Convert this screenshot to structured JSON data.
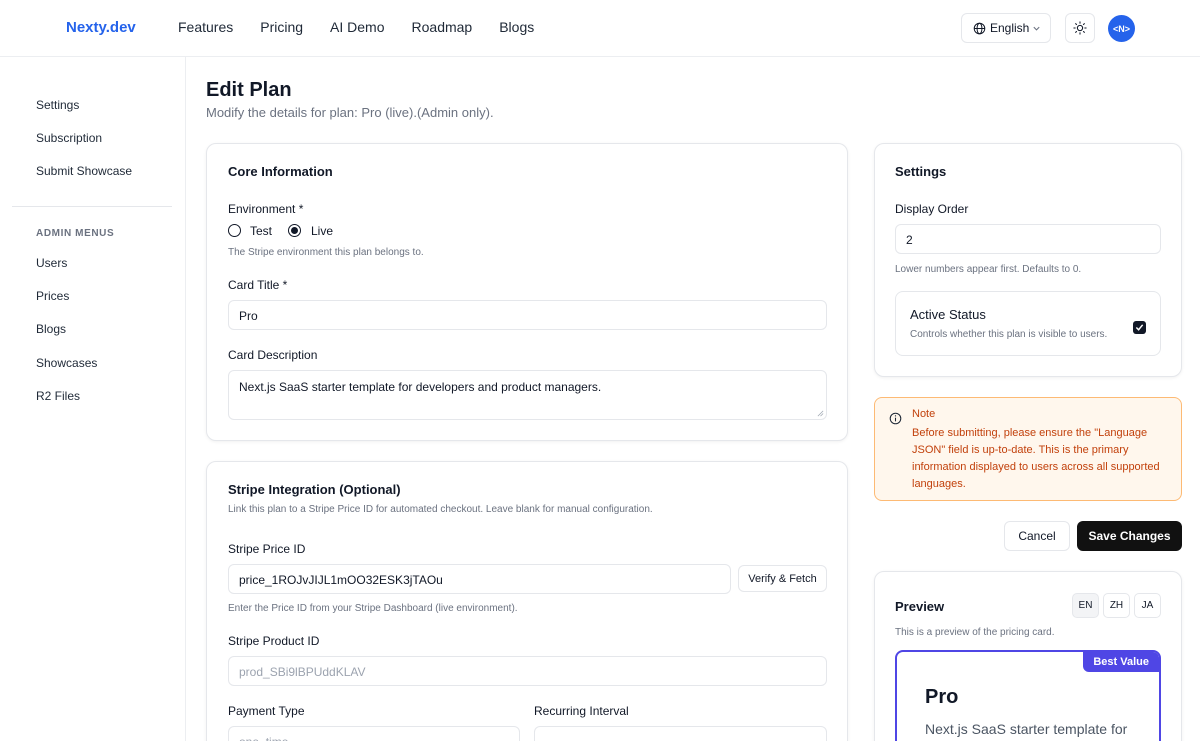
{
  "header": {
    "logo": "Nexty.dev",
    "nav": [
      "Features",
      "Pricing",
      "AI Demo",
      "Roadmap",
      "Blogs"
    ],
    "language": "English",
    "avatar_text": "<N>",
    "icons": {
      "globe": "globe-icon",
      "chevron": "chevron-down-icon",
      "theme": "sun-icon"
    }
  },
  "sidebar": {
    "items": [
      "Settings",
      "Subscription",
      "Submit Showcase"
    ],
    "admin_heading": "ADMIN MENUS",
    "admin_items": [
      "Users",
      "Prices",
      "Blogs",
      "Showcases",
      "R2 Files"
    ]
  },
  "page": {
    "title": "Edit Plan",
    "subtitle": "Modify the details for plan: Pro (live).(Admin only)."
  },
  "core": {
    "title": "Core Information",
    "environment_label": "Environment *",
    "env_options": [
      "Test",
      "Live"
    ],
    "env_selected": "Live",
    "environment_help": "The Stripe environment this plan belongs to.",
    "card_title_label": "Card Title *",
    "card_title_value": "Pro",
    "card_description_label": "Card Description",
    "card_description_value": "Next.js SaaS starter template for developers and product managers."
  },
  "stripe": {
    "title": "Stripe Integration (Optional)",
    "subtitle": "Link this plan to a Stripe Price ID for automated checkout. Leave blank for manual configuration.",
    "price_id_label": "Stripe Price ID",
    "price_id_value": "price_1ROJvJIJL1mOO32ESK3jTAOu",
    "verify_button": "Verify & Fetch",
    "price_id_help": "Enter the Price ID from your Stripe Dashboard (live environment).",
    "product_id_label": "Stripe Product ID",
    "product_id_value": "prod_SBi9lBPUddKLAV",
    "payment_type_label": "Payment Type",
    "payment_type_value": "one_time",
    "recurring_interval_label": "Recurring Interval"
  },
  "settings": {
    "title": "Settings",
    "display_order_label": "Display Order",
    "display_order_value": "2",
    "display_order_help": "Lower numbers appear first. Defaults to 0.",
    "active_status_label": "Active Status",
    "active_status_help": "Controls whether this plan is visible to users.",
    "active_checked": true
  },
  "note": {
    "title": "Note",
    "body": "Before submitting, please ensure the \"Language JSON\" field is up-to-date. This is the primary information displayed to users across all supported languages.",
    "icon": "info-icon"
  },
  "actions": {
    "cancel": "Cancel",
    "save": "Save Changes"
  },
  "preview": {
    "title": "Preview",
    "langs": [
      "EN",
      "ZH",
      "JA"
    ],
    "active_lang": "EN",
    "help": "This is a preview of the pricing card.",
    "badge": "Best Value",
    "plan_title": "Pro",
    "plan_desc": "Next.js SaaS starter template for"
  },
  "colors": {
    "brand": "#2563eb",
    "accent": "#4f46e5",
    "note_bg": "#fff7ed",
    "note_text": "#c2410c",
    "primary_button": "#111111"
  }
}
